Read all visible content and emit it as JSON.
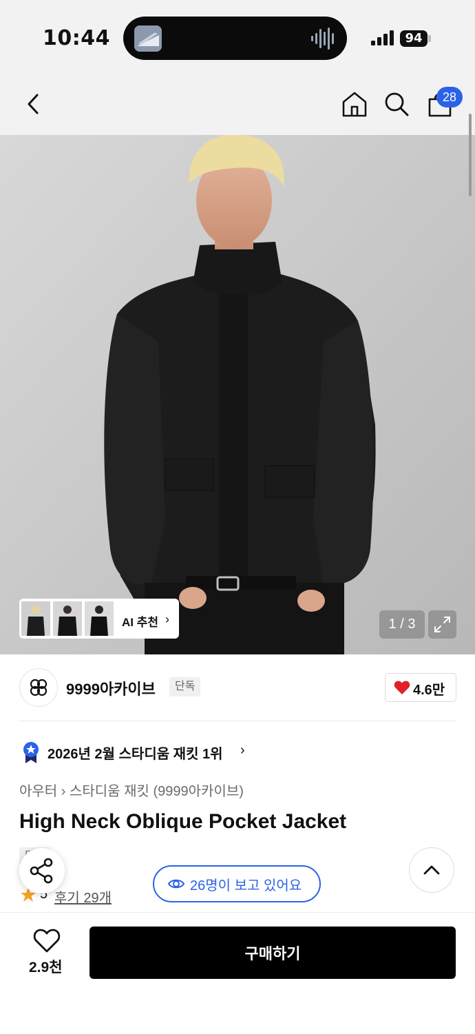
{
  "status_bar": {
    "time": "10:44",
    "battery": "94"
  },
  "header": {
    "cart_count": "28"
  },
  "gallery": {
    "ai_label": "AI 추천",
    "page_indicator": "1 / 3"
  },
  "brand": {
    "name": "9999아카이브",
    "exclusive_label": "단독",
    "likes": "4.6만"
  },
  "ranking": {
    "text": "2026년 2월 스타디움 재킷 1위"
  },
  "breadcrumb": {
    "category": "아우터",
    "subcategory": "스타디움 재킷 (9999아카이브)"
  },
  "product": {
    "name": "High Neck Oblique Pocket Jacket",
    "tag": "단독",
    "rating": "5",
    "reviews": "후기 29개",
    "viewing_text": "26명이 보고 있어요"
  },
  "bottom_bar": {
    "wish_count": "2.9천",
    "buy_label": "구매하기"
  },
  "colors": {
    "accent_blue": "#2b62e8",
    "like_red": "#e0202a",
    "buy_black": "#000000"
  },
  "icons": [
    "back-icon",
    "home-icon",
    "search-icon",
    "cart-icon",
    "expand-icon",
    "heart-icon",
    "ranking-badge-icon",
    "share-icon",
    "eye-icon",
    "chevron-up-icon",
    "star-icon"
  ]
}
